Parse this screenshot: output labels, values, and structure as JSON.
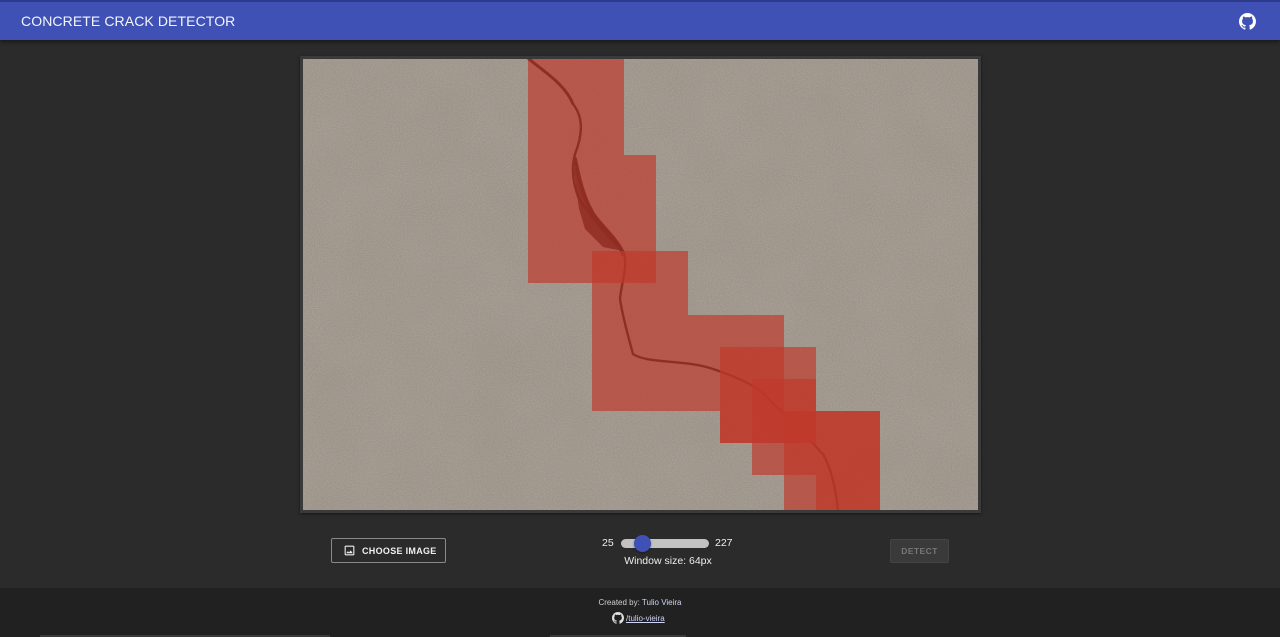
{
  "app": {
    "title": "CONCRETE CRACK DETECTOR",
    "accent_color": "#3f51b5"
  },
  "image_viewer": {
    "overlay_color": "#c0392b",
    "crack_regions": "highlighted red windows along diagonal crack"
  },
  "controls": {
    "choose_image_label": "CHOOSE IMAGE",
    "slider": {
      "min": "25",
      "max": "227",
      "value": 64,
      "window_label": "Window size: 64px"
    },
    "detect_label": "DETECT"
  },
  "footer": {
    "created_by": "Created by:",
    "author": "Tulio Vieira",
    "github_handle": "/tulio-vieira"
  },
  "icons": {
    "github": "github-icon",
    "image": "image-icon"
  }
}
